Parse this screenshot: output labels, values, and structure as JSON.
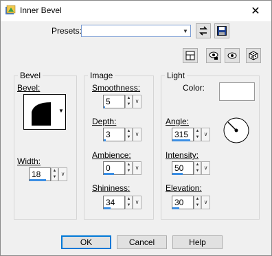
{
  "window": {
    "title": "Inner Bevel",
    "close_glyph": "✕"
  },
  "presets": {
    "label": "Presets:",
    "value": ""
  },
  "toolbar": {
    "icons": [
      "reset-icon",
      "save-preset-icon",
      "layout-icon",
      "proof-icon",
      "preview-icon",
      "randomize-icon"
    ]
  },
  "bevel_group": {
    "title": "Bevel",
    "bevel_label": "Bevel:",
    "width_label": "Width:",
    "width_value": "18",
    "width_fill": 0.8
  },
  "image_group": {
    "title": "Image",
    "smoothness_label": "Smoothness:",
    "smoothness_value": "5",
    "smoothness_fill": 0.05,
    "depth_label": "Depth:",
    "depth_value": "3",
    "depth_fill": 0.1,
    "ambience_label": "Ambience:",
    "ambience_value": "0",
    "ambience_fill": 0.5,
    "shininess_label": "Shininess:",
    "shininess_value": "34",
    "shininess_fill": 0.34
  },
  "light_group": {
    "title": "Light",
    "color_label": "Color:",
    "color_value": "#ffffff",
    "angle_label": "Angle:",
    "angle_value": "315",
    "angle_fill": 0.87,
    "intensity_label": "Intensity:",
    "intensity_value": "50",
    "intensity_fill": 0.5,
    "elevation_label": "Elevation:",
    "elevation_value": "30",
    "elevation_fill": 0.33
  },
  "buttons": {
    "ok": "OK",
    "cancel": "Cancel",
    "help": "Help"
  },
  "colors": {
    "accent": "#3c8fe4",
    "focus": "#0078d7"
  }
}
